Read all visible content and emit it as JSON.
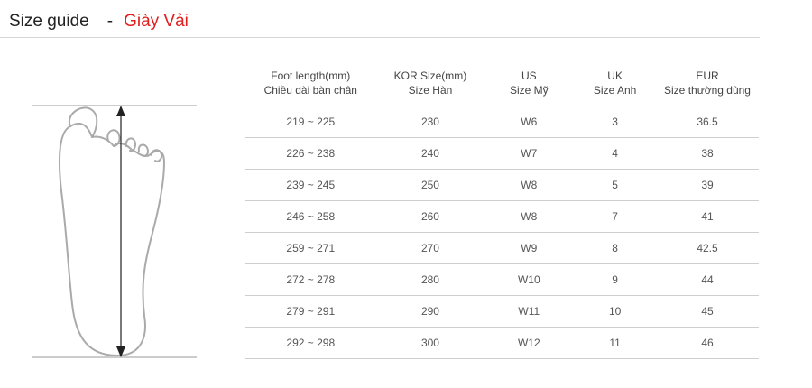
{
  "header": {
    "title": "Size guide",
    "separator": "-",
    "product": "Giày Vải"
  },
  "colors": {
    "accent": "#e01e1e"
  },
  "illustration": {
    "icon": "foot-outline-icon"
  },
  "table": {
    "columns": [
      {
        "line1": "Foot length(mm)",
        "line2": "Chiều dài bàn chân"
      },
      {
        "line1": "KOR Size(mm)",
        "line2": "Size Hàn"
      },
      {
        "line1": "US",
        "line2": "Size Mỹ"
      },
      {
        "line1": "UK",
        "line2": "Size Anh"
      },
      {
        "line1": "EUR",
        "line2": "Size thường dùng"
      }
    ],
    "rows": [
      [
        "219 ~ 225",
        "230",
        "W6",
        "3",
        "36.5"
      ],
      [
        "226 ~ 238",
        "240",
        "W7",
        "4",
        "38"
      ],
      [
        "239 ~ 245",
        "250",
        "W8",
        "5",
        "39"
      ],
      [
        "246 ~ 258",
        "260",
        "W8",
        "7",
        "41"
      ],
      [
        "259 ~ 271",
        "270",
        "W9",
        "8",
        "42.5"
      ],
      [
        "272 ~ 278",
        "280",
        "W10",
        "9",
        "44"
      ],
      [
        "279 ~ 291",
        "290",
        "W11",
        "10",
        "45"
      ],
      [
        "292 ~ 298",
        "300",
        "W12",
        "11",
        "46"
      ]
    ]
  }
}
